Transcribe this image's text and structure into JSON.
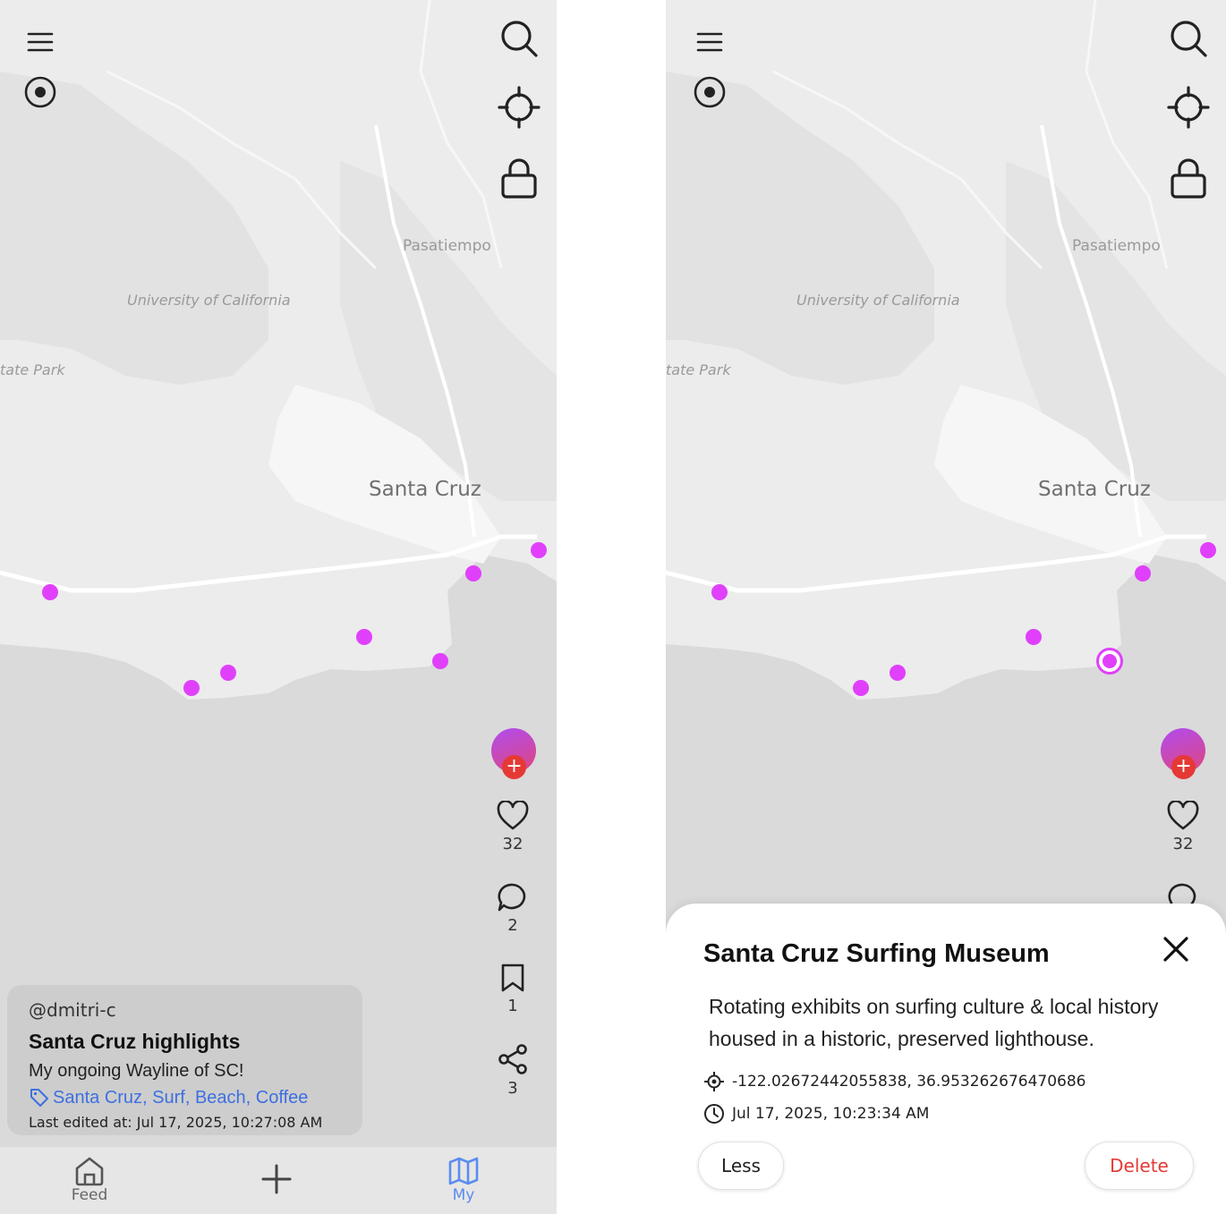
{
  "colors": {
    "marker": "#e040fb",
    "accent_blue": "#3d6fe0",
    "danger": "#e53935",
    "card_bg": "#cdcdcd",
    "nav_bg": "#e6e6e6"
  },
  "map": {
    "labels": {
      "pasatiempo": "Pasatiempo",
      "university": "University of California",
      "state_park": "tate Park",
      "city": "Santa Cruz"
    }
  },
  "toolbar": {
    "menu_icon": "menu-icon",
    "record_icon": "record-icon",
    "search_icon": "search-icon",
    "locate_icon": "crosshair-icon",
    "lock_icon": "lock-icon"
  },
  "actions": {
    "likes": "32",
    "comments": "2",
    "saves": "1",
    "shares": "3"
  },
  "card": {
    "handle": "@dmitri-c",
    "title": "Santa Cruz highlights",
    "description": "My ongoing Wayline of SC!",
    "tags": "Santa Cruz, Surf, Beach, Coffee",
    "last_edited": "Last edited at: Jul 17, 2025, 10:27:08 AM"
  },
  "nav": {
    "feed": "Feed",
    "add_icon": "plus-icon",
    "my": "My"
  },
  "detail": {
    "title": "Santa Cruz Surfing Museum",
    "description": "Rotating exhibits on surfing culture & local history housed in a historic, preserved lighthouse.",
    "coordinates": "-122.02672442055838, 36.953262676470686",
    "timestamp": "Jul 17, 2025, 10:23:34 AM",
    "less_label": "Less",
    "delete_label": "Delete"
  }
}
